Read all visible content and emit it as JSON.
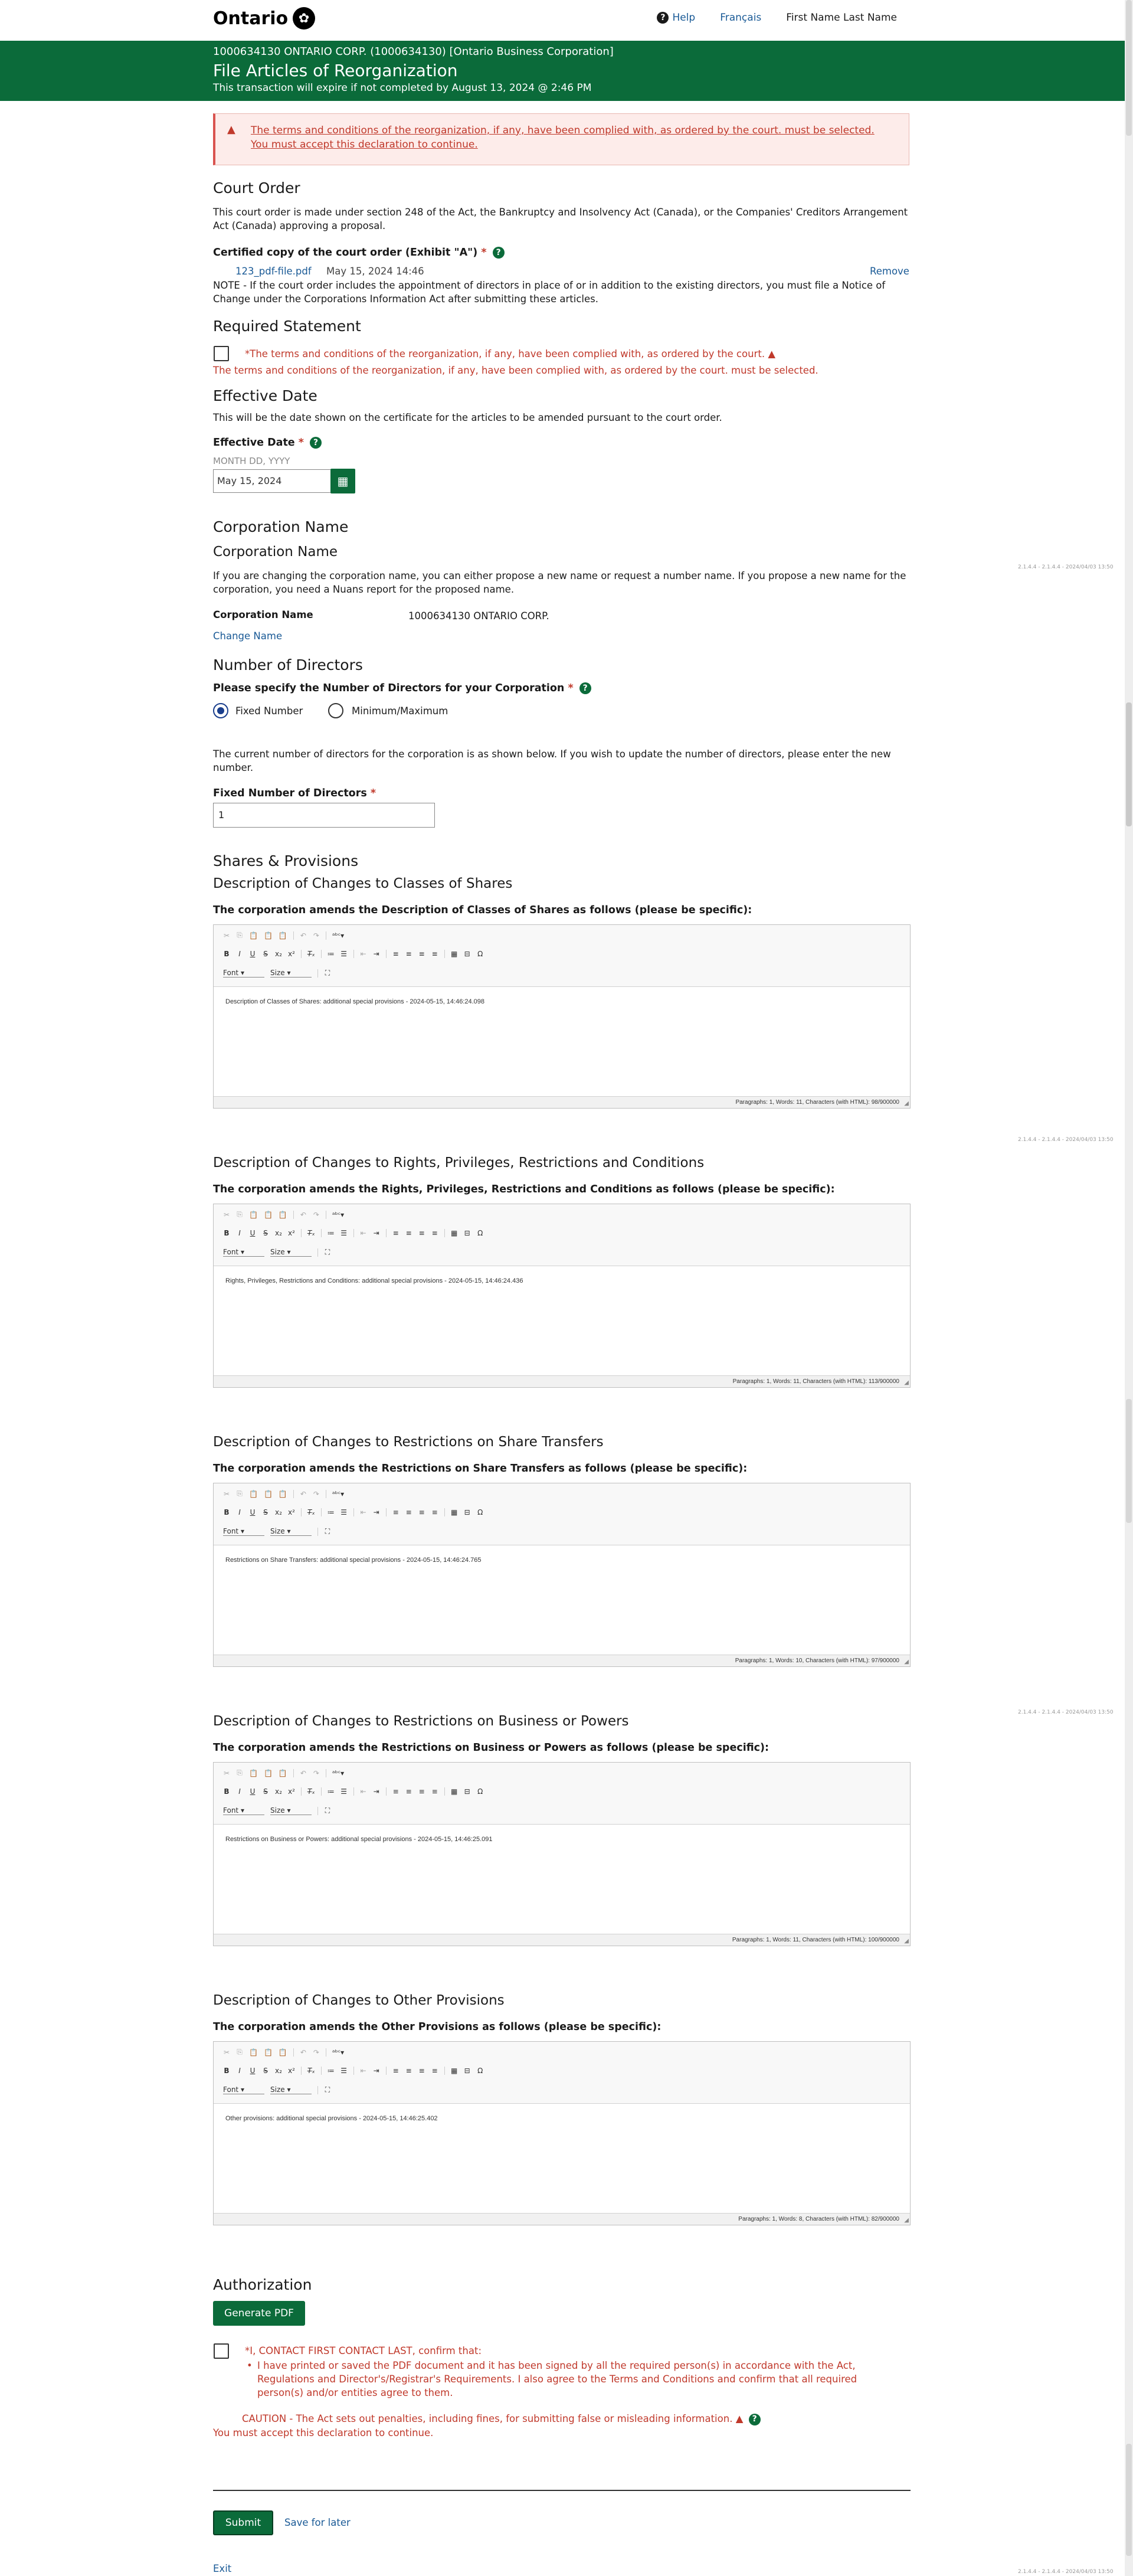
{
  "header": {
    "logo_text": "Ontario",
    "help_label": "Help",
    "language_label": "Français",
    "user_name": "First Name Last Name"
  },
  "banner": {
    "company_line": "1000634130 ONTARIO CORP. (1000634130) [Ontario Business Corporation]",
    "title": "File Articles of Reorganization",
    "expiry": "This transaction will expire if not completed by August 13, 2024 @ 2:46 PM"
  },
  "alert": {
    "line1": "The terms and conditions of the reorganization, if any, have been complied with, as ordered by the court. must be selected.",
    "line2": "You must accept this declaration to continue."
  },
  "court_order": {
    "heading": "Court Order",
    "description": "This court order is made under section 248 of the Act, the Bankruptcy and Insolvency Act (Canada), or the Companies' Creditors Arrangement Act (Canada) approving a proposal.",
    "certified_label": "Certified copy of the court order (Exhibit \"A\")",
    "file_name": "123_pdf-file.pdf",
    "file_date": "May 15, 2024 14:46",
    "remove_label": "Remove",
    "note": "NOTE - If the court order includes the appointment of directors in place of or in addition to the existing directors, you must file a Notice of Change under the Corporations Information Act after submitting these articles."
  },
  "required_statement": {
    "heading": "Required Statement",
    "checkbox_label": "*The terms and conditions of the reorganization, if any, have been complied with, as ordered by the court.",
    "error": "The terms and conditions of the reorganization, if any, have been complied with, as ordered by the court. must be selected."
  },
  "effective_date": {
    "heading": "Effective Date",
    "description": "This will be the date shown on the certificate for the articles to be amended pursuant to the court order.",
    "label": "Effective Date",
    "format_hint": "MONTH DD, YYYY",
    "value": "May 15, 2024"
  },
  "corporation_name": {
    "heading": "Corporation Name",
    "subheading": "Corporation Name",
    "description": "If you are changing the corporation name, you can either propose a new name or request a number name. If you propose a new name for the corporation, you need a Nuans report for the proposed name.",
    "name_label": "Corporation Name",
    "name_value": "1000634130 ONTARIO CORP.",
    "change_link": "Change Name"
  },
  "directors": {
    "heading": "Number of Directors",
    "question": "Please specify the Number of Directors for your Corporation",
    "option_fixed": "Fixed Number",
    "option_minmax": "Minimum/Maximum",
    "description": "The current number of directors for the corporation is as shown below. If you wish to update the number of directors, please enter the new number.",
    "fixed_label": "Fixed Number of Directors",
    "fixed_value": "1"
  },
  "shares": {
    "heading": "Shares & Provisions"
  },
  "editors": [
    {
      "heading": "Description of Changes to Classes of Shares",
      "question": "The corporation amends the Description of Classes of Shares as follows (please be specific):",
      "content": "Description of Classes of Shares: additional special provisions - 2024-05-15, 14:46:24.098",
      "status": "Paragraphs: 1, Words: 11, Characters (with HTML): 98/900000"
    },
    {
      "heading": "Description of Changes to Rights, Privileges, Restrictions and Conditions",
      "question": "The corporation amends the Rights, Privileges, Restrictions and Conditions as follows (please be specific):",
      "content": "Rights, Privileges, Restrictions and Conditions: additional special provisions - 2024-05-15, 14:46:24.436",
      "status": "Paragraphs: 1, Words: 11, Characters (with HTML): 113/900000"
    },
    {
      "heading": "Description of Changes to Restrictions on Share Transfers",
      "question": "The corporation amends the Restrictions on Share Transfers as follows (please be specific):",
      "content": "Restrictions on Share Transfers: additional special provisions - 2024-05-15, 14:46:24.765",
      "status": "Paragraphs: 1, Words: 10, Characters (with HTML): 97/900000"
    },
    {
      "heading": "Description of Changes to Restrictions on Business or Powers",
      "question": "The corporation amends the Restrictions on Business or Powers as follows (please be specific):",
      "content": "Restrictions on Business or Powers: additional special provisions - 2024-05-15, 14:46:25.091",
      "status": "Paragraphs: 1, Words: 11, Characters (with HTML): 100/900000"
    },
    {
      "heading": "Description of Changes to Other Provisions",
      "question": "The corporation amends the Other Provisions as follows (please be specific):",
      "content": "Other provisions: additional special provisions - 2024-05-15, 14:46:25.402",
      "status": "Paragraphs: 1, Words: 8, Characters (with HTML): 82/900000"
    }
  ],
  "editor_toolbar": {
    "font_label": "Font",
    "size_label": "Size"
  },
  "version_text": "2.1.4.4 - 2.1.4.4 - 2024/04/03 13:50",
  "authorization": {
    "heading": "Authorization",
    "generate_pdf": "Generate PDF",
    "confirm_label": "*I, CONTACT FIRST CONTACT LAST, confirm that:",
    "bullet": "I have printed or saved the PDF document and it has been signed by all the required person(s) in accordance with the Act, Regulations and Director's/Registrar's Requirements. I also agree to the Terms and Conditions and confirm that all required person(s) and/or entities agree to them.",
    "caution": "CAUTION - The Act sets out penalties, including fines, for submitting false or misleading information.",
    "error": "You must accept this declaration to continue."
  },
  "footer": {
    "submit": "Submit",
    "save_later": "Save for later",
    "exit": "Exit"
  }
}
